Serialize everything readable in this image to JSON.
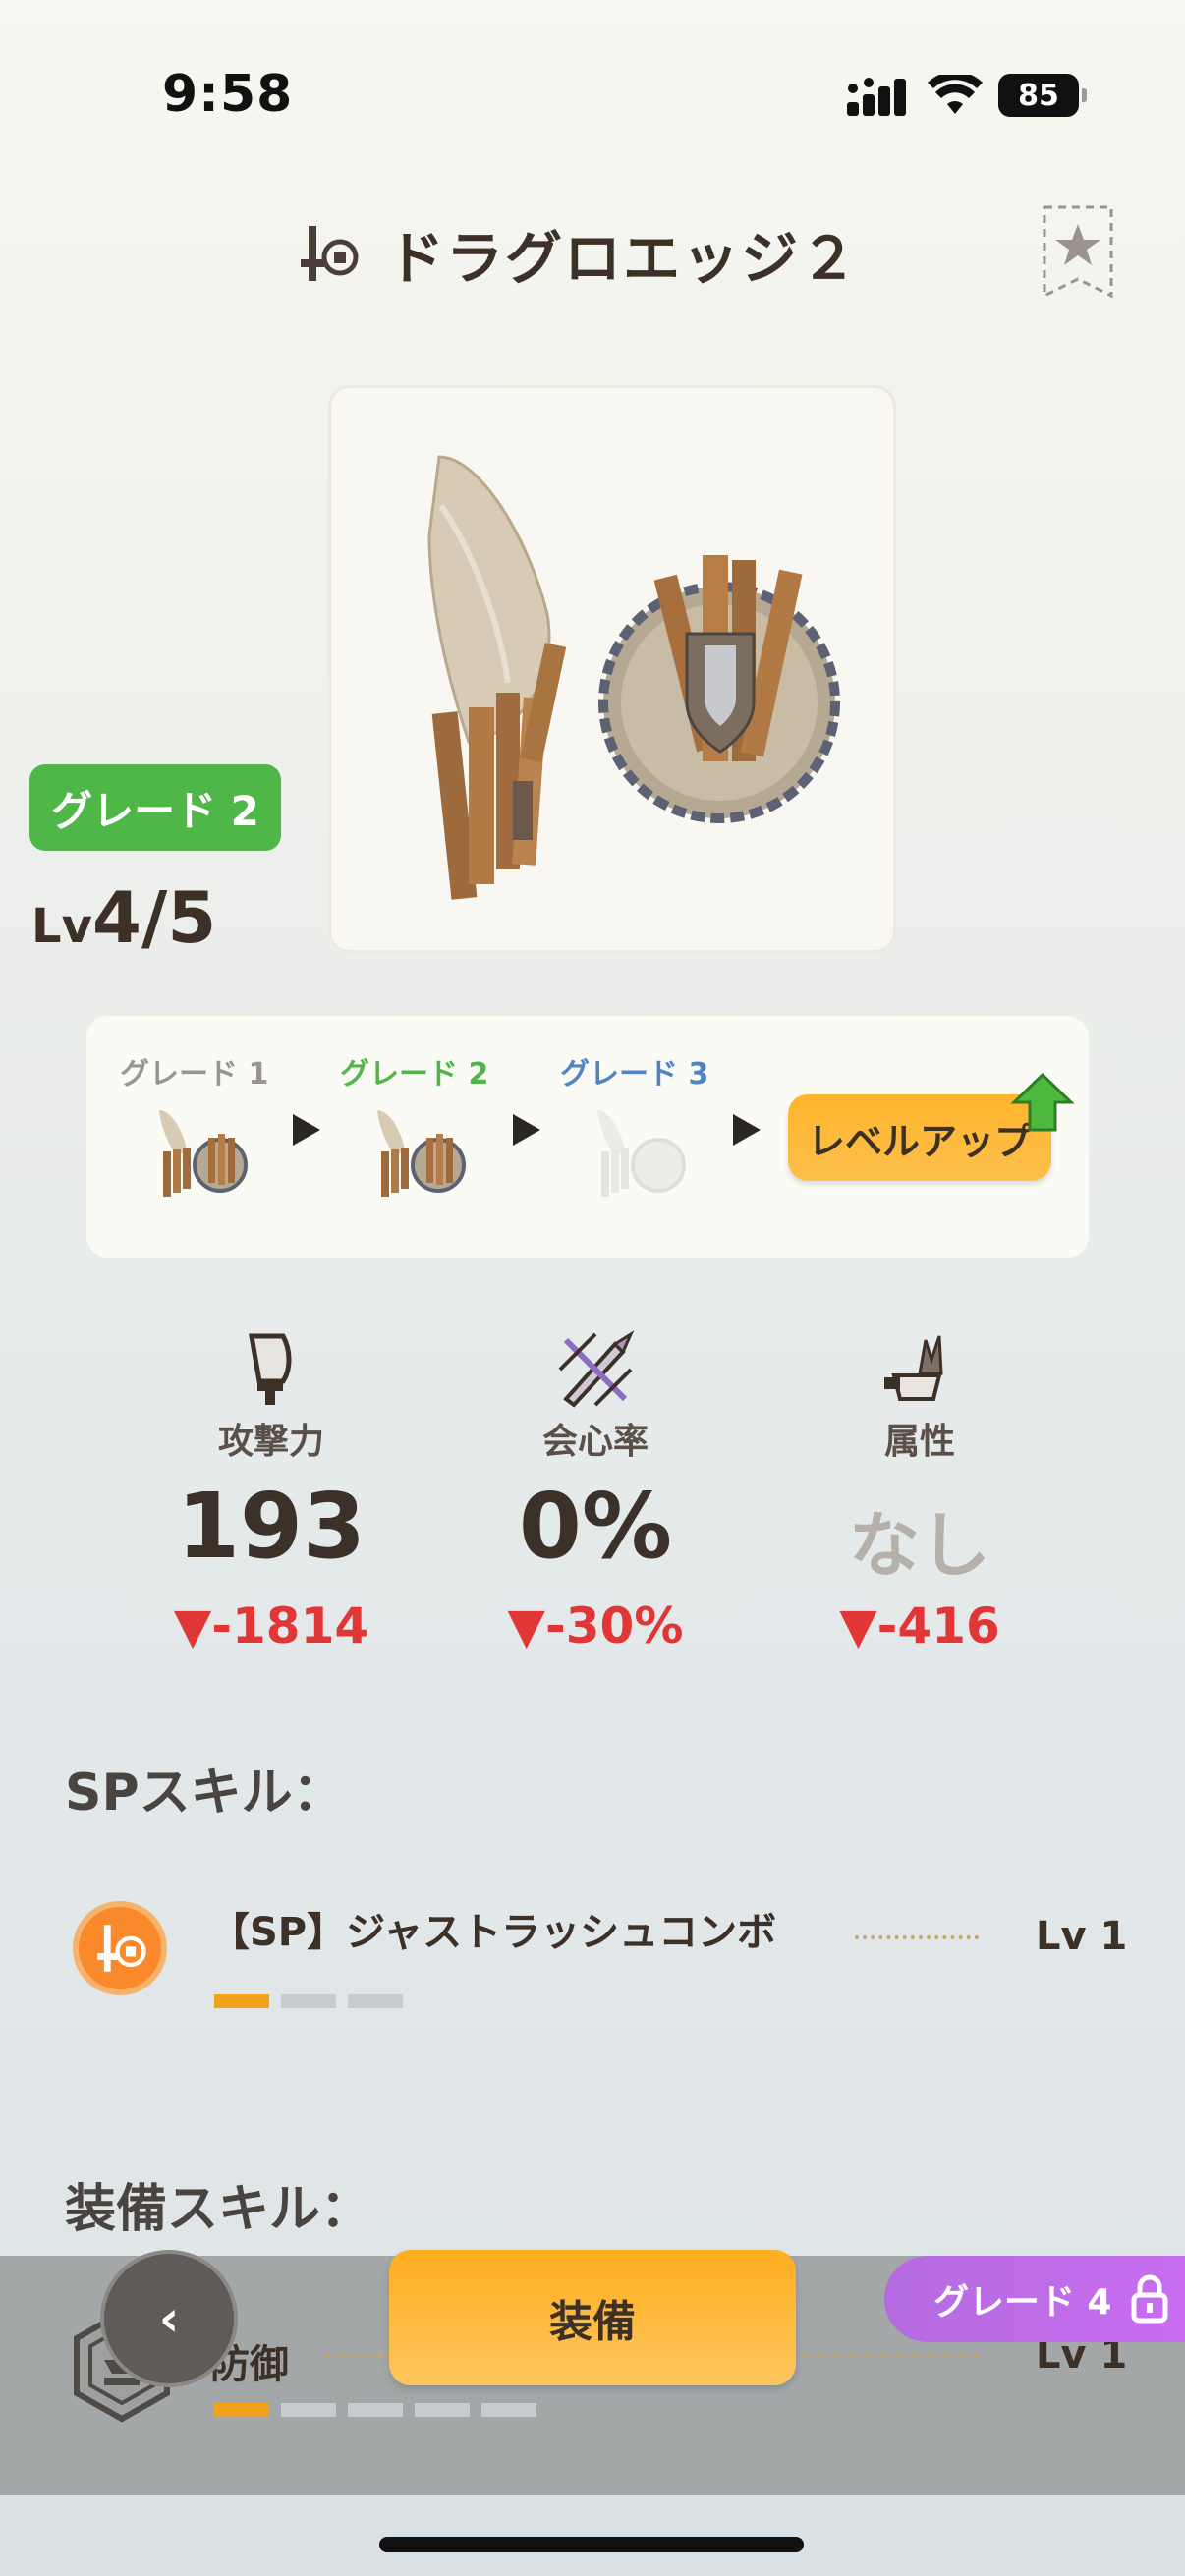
{
  "status_bar": {
    "time": "9:58",
    "battery": "85"
  },
  "header": {
    "title": "ドラグロエッジ２"
  },
  "weapon": {
    "grade_badge": "グレード 2",
    "level_prefix": "Lv",
    "level_value": "4/5"
  },
  "grades": {
    "items": [
      {
        "label": "グレード 1",
        "color": "#9a9590"
      },
      {
        "label": "グレード 2",
        "color": "#4fb648"
      },
      {
        "label": "グレード 3",
        "color": "#4f83c4"
      }
    ],
    "level_up_label": "レベルアップ"
  },
  "stats": [
    {
      "icon": "attack-icon",
      "label": "攻撃力",
      "value": "193",
      "diff": "▼-1814"
    },
    {
      "icon": "critical-icon",
      "label": "会心率",
      "value": "0%",
      "diff": "▼-30%"
    },
    {
      "icon": "element-icon",
      "label": "属性",
      "value": "なし",
      "diff": "▼-416"
    }
  ],
  "sp_skills": {
    "title": "SPスキル：",
    "items": [
      {
        "name": "【SP】ジャストラッシュコンボ",
        "level": "Lv 1",
        "filled": 1,
        "total": 3
      }
    ]
  },
  "equip_skills": {
    "title": "装備スキル：",
    "items": [
      {
        "name": "防御",
        "level": "Lv 1",
        "filled": 1,
        "total": 5
      }
    ]
  },
  "actions": {
    "equip_label": "装備",
    "grade_lock_label": "グレード 4"
  },
  "colors": {
    "accent_orange": "#ffb52b",
    "grade_green": "#4fb648",
    "grade_blue": "#4f83c4",
    "diff_red": "#e13636",
    "lock_purple": "#c86df0"
  }
}
